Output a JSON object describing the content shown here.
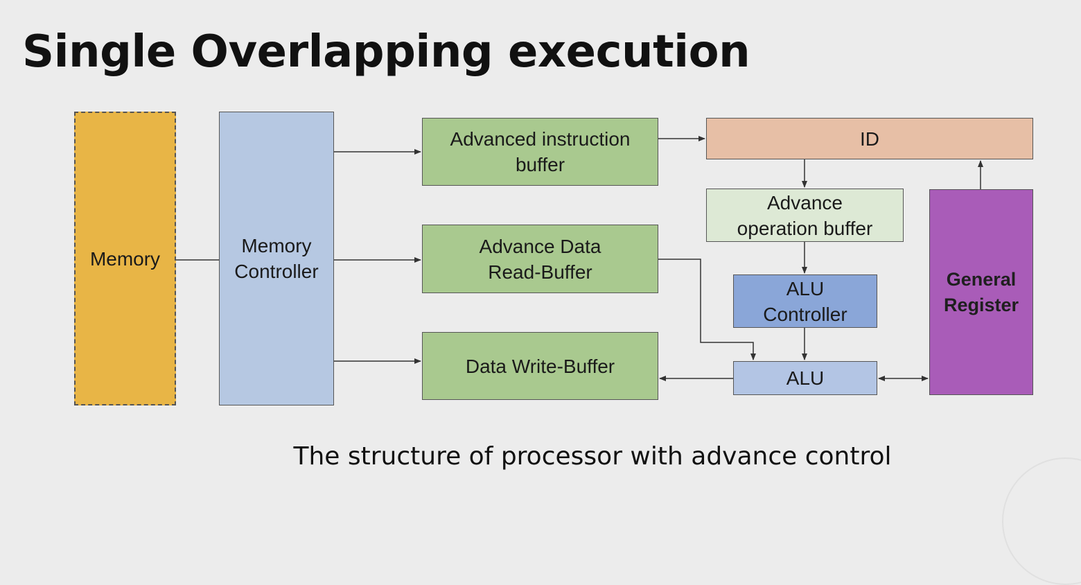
{
  "slide": {
    "title": "Single Overlapping execution",
    "caption": "The structure of processor with advance control"
  },
  "blocks": {
    "memory": "Memory",
    "memory_controller": "Memory\nController",
    "advanced_instruction_buffer": "Advanced instruction\nbuffer",
    "advance_data_read_buffer": "Advance Data\nRead-Buffer",
    "data_write_buffer": "Data Write-Buffer",
    "id": "ID",
    "advance_operation_buffer": "Advance\noperation buffer",
    "alu_controller": "ALU\nController",
    "alu": "ALU",
    "general_register": "General\nRegister"
  },
  "colors": {
    "background": "#ececec",
    "memory": "#e8b546",
    "memory_controller": "#b6c8e2",
    "buffers": "#a9c98f",
    "id": "#e7bfa6",
    "advance_operation_buffer": "#dde9d5",
    "alu_controller": "#8aa6d8",
    "alu": "#b3c5e4",
    "general_register": "#a95cb8"
  }
}
